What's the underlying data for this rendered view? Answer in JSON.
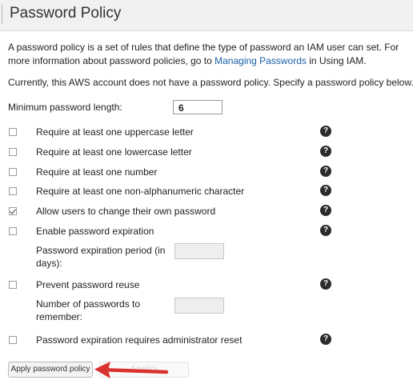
{
  "page": {
    "title": "Password Policy",
    "description_prefix": "A password policy is a set of rules that define the type of password an IAM user can set. For more information about password policies, go to ",
    "description_link": "Managing Passwords",
    "description_suffix": " in Using IAM.",
    "status": "Currently, this AWS account does not have a password policy. Specify a password policy below."
  },
  "min_length": {
    "label": "Minimum password length:",
    "value": "6"
  },
  "options": [
    {
      "label": "Require at least one uppercase letter",
      "checked": false
    },
    {
      "label": "Require at least one lowercase letter",
      "checked": false
    },
    {
      "label": "Require at least one number",
      "checked": false
    },
    {
      "label": "Require at least one non-alphanumeric character",
      "checked": false
    },
    {
      "label": "Allow users to change their own password",
      "checked": true
    },
    {
      "label": "Enable password expiration",
      "checked": false
    },
    {
      "label": "Prevent password reuse",
      "checked": false
    },
    {
      "label": "Password expiration requires administrator reset",
      "checked": false
    }
  ],
  "expiration_period": {
    "label": "Password expiration period (in days):",
    "value": ""
  },
  "reuse_count": {
    "label": "Number of passwords to remember:",
    "value": ""
  },
  "help_glyph": "?",
  "actions": {
    "apply": "Apply password policy",
    "ghost": "d policy"
  },
  "colors": {
    "link": "#1a5fa8",
    "arrow": "#d9322c"
  },
  "icons": {
    "help": "help-icon",
    "arrow": "arrow-left-icon"
  }
}
